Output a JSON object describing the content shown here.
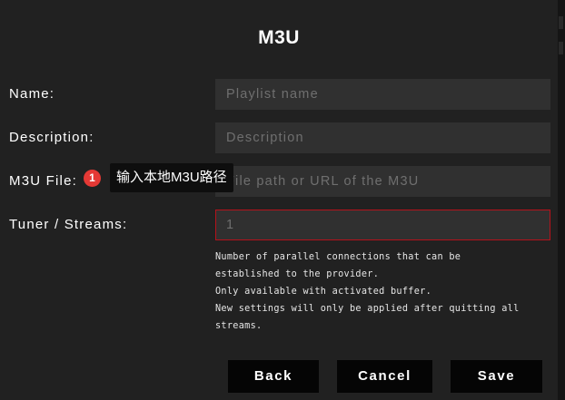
{
  "dialog": {
    "title": "M3U"
  },
  "form": {
    "name": {
      "label": "Name:",
      "placeholder": "Playlist name"
    },
    "description": {
      "label": "Description:",
      "placeholder": "Description"
    },
    "m3u_file": {
      "label": "M3U File:",
      "placeholder": "File path or URL of the M3U"
    },
    "tuner": {
      "label": "Tuner / Streams:",
      "value": "1"
    }
  },
  "help_text": {
    "lines": [
      "Number of parallel connections that can be",
      "established to the provider.",
      "Only available with activated buffer.",
      "New settings will only be applied after quitting all",
      "streams."
    ]
  },
  "buttons": {
    "back": "Back",
    "cancel": "Cancel",
    "save": "Save"
  },
  "annotation": {
    "badge": "1",
    "tooltip": "输入本地M3U路径"
  },
  "colors": {
    "background": "#212121",
    "field": "#303030",
    "error_border": "#b5121b",
    "badge": "#e53935",
    "button": "#050505"
  }
}
